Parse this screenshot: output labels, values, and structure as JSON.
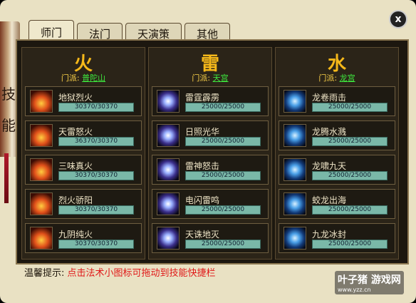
{
  "scroll": {
    "text": "技能"
  },
  "tabs": [
    {
      "label": "师门",
      "active": true
    },
    {
      "label": "法门",
      "active": false
    },
    {
      "label": "天演策",
      "active": false
    },
    {
      "label": "其他",
      "active": false
    }
  ],
  "close_label": "x",
  "columns": [
    {
      "title": "火",
      "sect_label": "门派:",
      "sect_name": "普陀山",
      "skills": [
        {
          "name": "地狱烈火",
          "value": "30370/30370",
          "icon": "fire-icon"
        },
        {
          "name": "天雷怒火",
          "value": "36370/30370",
          "icon": "fire-icon"
        },
        {
          "name": "三味真火",
          "value": "30370/30370",
          "icon": "fire-icon"
        },
        {
          "name": "烈火骄阳",
          "value": "30370/30370",
          "icon": "fire-icon"
        },
        {
          "name": "九阴纯火",
          "value": "30370/30370",
          "icon": "fire-icon"
        }
      ]
    },
    {
      "title": "雷",
      "sect_label": "门派:",
      "sect_name": "天宫",
      "skills": [
        {
          "name": "雷霆霹雳",
          "value": "25000/25000",
          "icon": "thunder-icon"
        },
        {
          "name": "日照光华",
          "value": "25000/25000",
          "icon": "thunder-icon"
        },
        {
          "name": "雷神怒击",
          "value": "25000/25000",
          "icon": "thunder-icon"
        },
        {
          "name": "电闪雷鸣",
          "value": "25000/25000",
          "icon": "thunder-icon"
        },
        {
          "name": "天诛地灭",
          "value": "25000/25000",
          "icon": "thunder-icon"
        }
      ]
    },
    {
      "title": "水",
      "sect_label": "门派:",
      "sect_name": "龙宫",
      "skills": [
        {
          "name": "龙卷雨击",
          "value": "25000/25000",
          "icon": "water-icon"
        },
        {
          "name": "龙腾水溅",
          "value": "25000/25000",
          "icon": "water-icon"
        },
        {
          "name": "龙啸九天",
          "value": "25000/25000",
          "icon": "water-icon"
        },
        {
          "name": "蛟龙出海",
          "value": "25000/25000",
          "icon": "water-icon"
        },
        {
          "name": "九龙冰封",
          "value": "25000/25000",
          "icon": "water-icon"
        }
      ]
    }
  ],
  "tip": {
    "label": "温馨提示:",
    "text": "点击法术小图标可拖动到技能快捷栏"
  },
  "watermark": {
    "name": "叶子猪",
    "badge": "游戏网",
    "url": "www.yzz.cn"
  }
}
